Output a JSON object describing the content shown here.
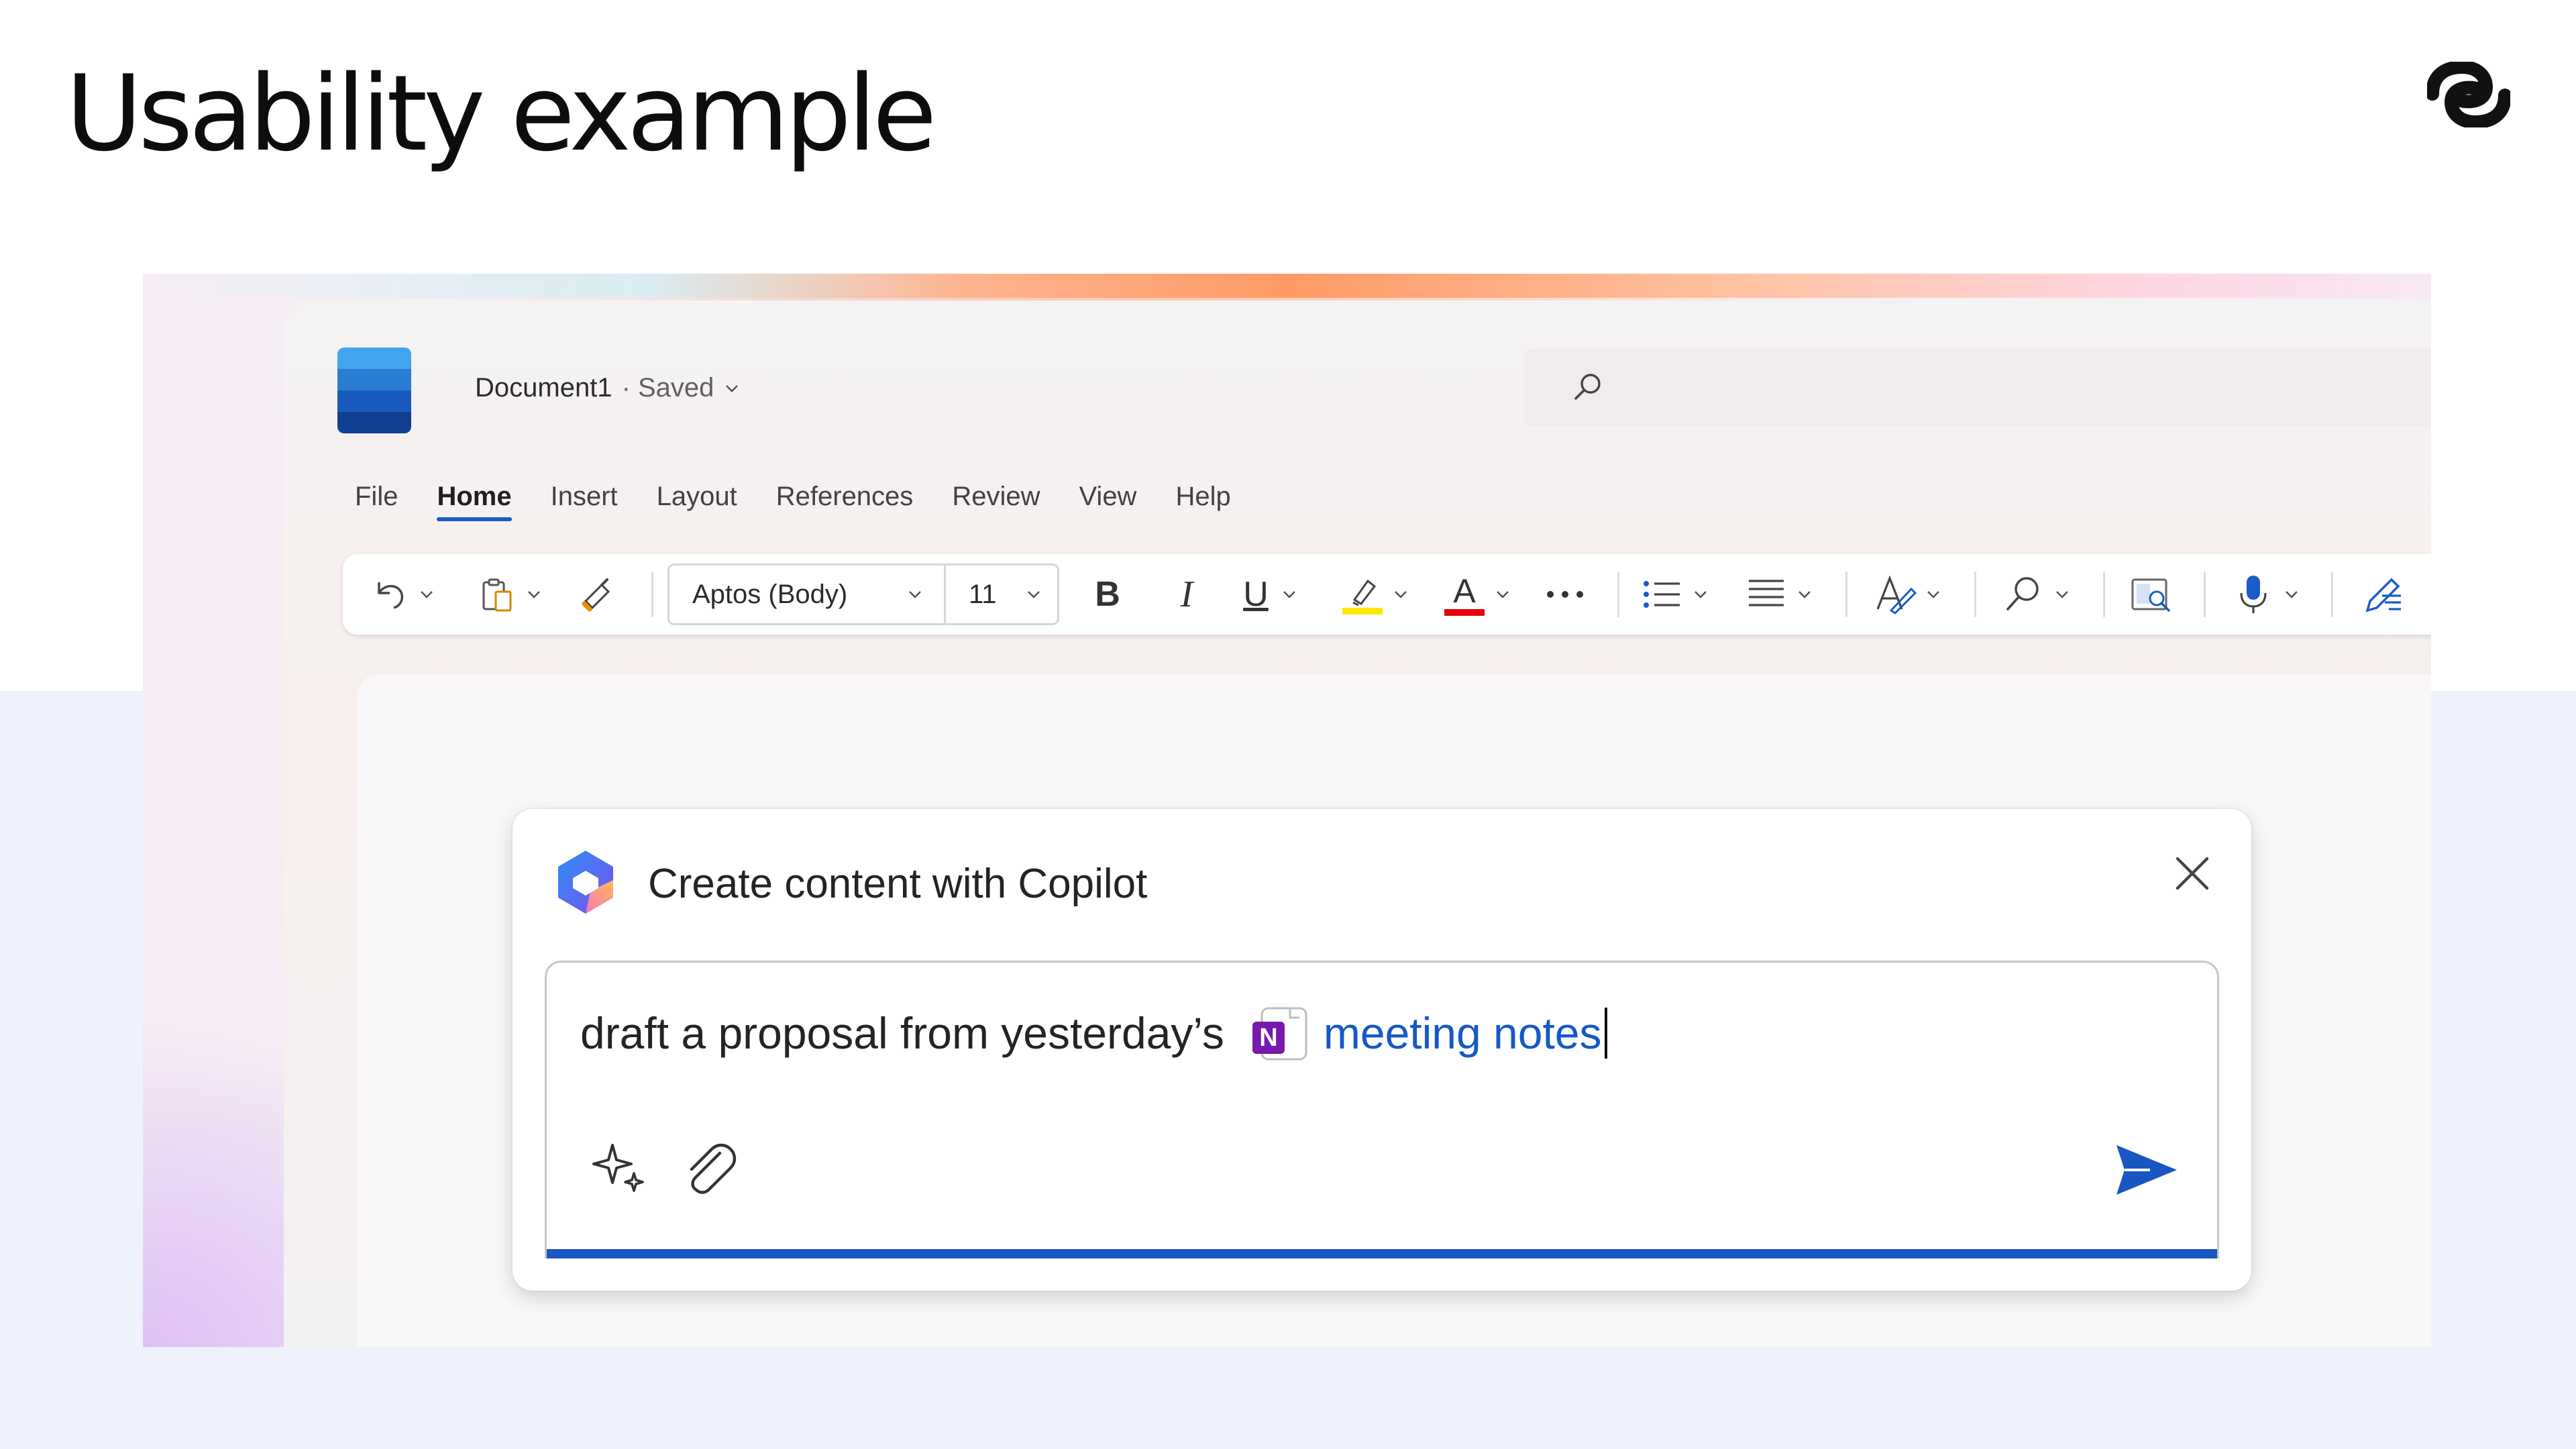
{
  "slide": {
    "title": "Usability example"
  },
  "brand": {
    "logo_icon": "brand-logo-icon"
  },
  "document": {
    "title": "Document1",
    "status": "· Saved"
  },
  "ribbon": {
    "tabs": [
      {
        "label": "File",
        "active": false
      },
      {
        "label": "Home",
        "active": true
      },
      {
        "label": "Insert",
        "active": false
      },
      {
        "label": "Layout",
        "active": false
      },
      {
        "label": "References",
        "active": false
      },
      {
        "label": "Review",
        "active": false
      },
      {
        "label": "View",
        "active": false
      },
      {
        "label": "Help",
        "active": false
      }
    ]
  },
  "toolbar": {
    "font_name": "Aptos (Body)",
    "font_size": "11",
    "bold_label": "B",
    "italic_label": "I",
    "underline_label": "U",
    "font_color_label": "A",
    "highlight_color": "#ffe600",
    "font_color": "#e3000f"
  },
  "copilot": {
    "title": "Create content with Copilot",
    "prompt_text": "draft a proposal from yesterday’s",
    "reference_label": "meeting notes",
    "reference_icon_letter": "N",
    "accent_color": "#1a56c2",
    "reference_color": "#7719aa"
  }
}
